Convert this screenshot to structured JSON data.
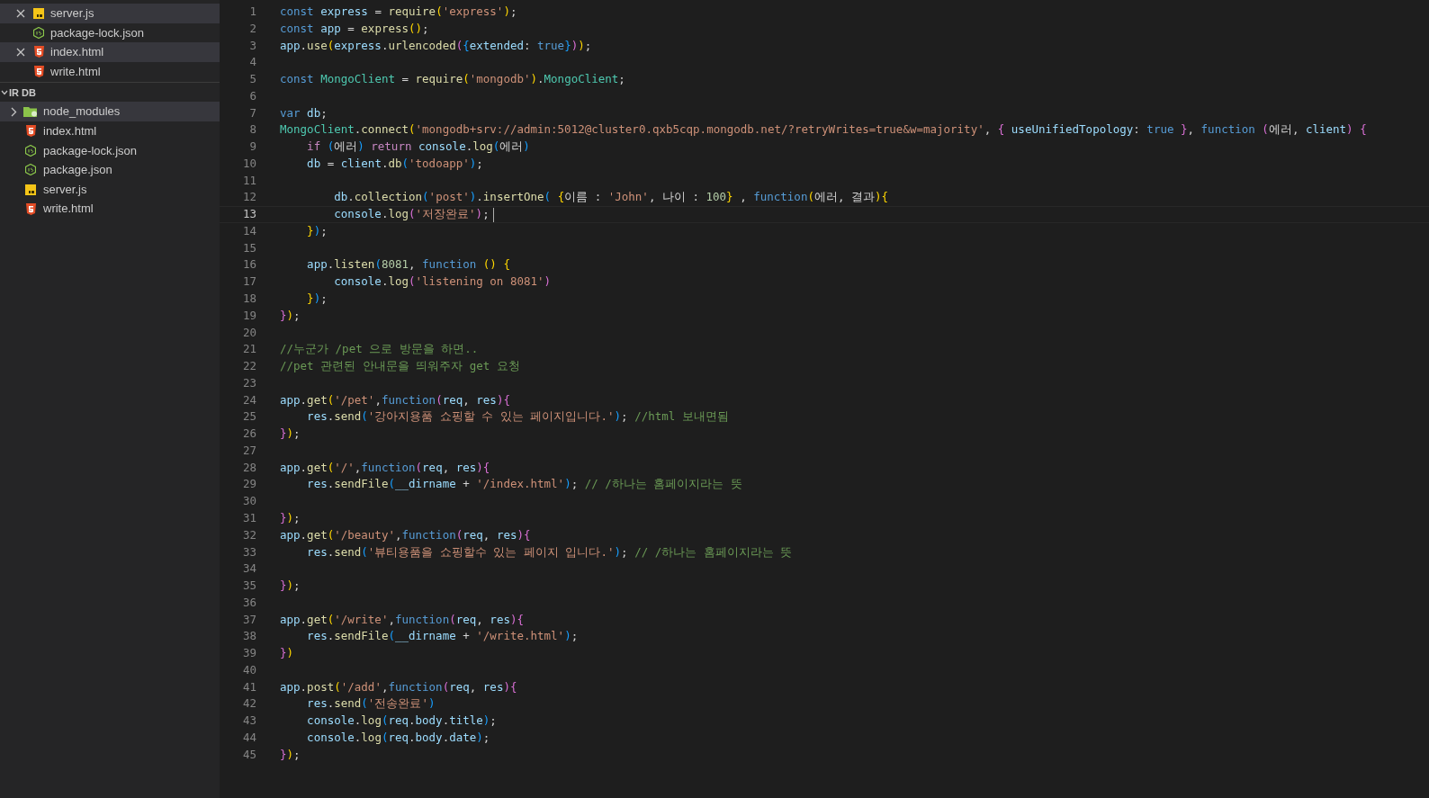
{
  "open_editors": [
    {
      "name": "server.js",
      "kind": "js",
      "selected": true
    },
    {
      "name": "package-lock.json",
      "kind": "json",
      "selected": false
    },
    {
      "name": "index.html",
      "kind": "html",
      "selected": true
    },
    {
      "name": "write.html",
      "kind": "html",
      "selected": false
    }
  ],
  "folder": {
    "name": "IR DB",
    "expanded": true,
    "items": [
      {
        "name": "node_modules",
        "kind": "folder",
        "expanded": false,
        "selected": true
      },
      {
        "name": "index.html",
        "kind": "html",
        "selected": false
      },
      {
        "name": "package-lock.json",
        "kind": "json",
        "selected": false
      },
      {
        "name": "package.json",
        "kind": "json",
        "selected": false
      },
      {
        "name": "server.js",
        "kind": "js",
        "selected": false
      },
      {
        "name": "write.html",
        "kind": "html",
        "selected": false
      }
    ]
  },
  "editor": {
    "lines": [
      {
        "number": "1",
        "text": "const express = require('express');",
        "active": false
      },
      {
        "number": "2",
        "text": "const app = express();",
        "active": false
      },
      {
        "number": "3",
        "text": "app.use(express.urlencoded({extended: true}));",
        "active": false
      },
      {
        "number": "4",
        "active": false
      },
      {
        "number": "5",
        "text": "const MongoClient = require('mongodb').MongoClient;",
        "active": false
      },
      {
        "number": "6",
        "active": false
      },
      {
        "number": "7",
        "text": "var db;",
        "active": false
      },
      {
        "number": "8",
        "text": "MongoClient.connect('mongodb+srv://admin:5012@cluster0.qxb5cqp.mongodb.net/?retryWrites=true&w=majority', { useUnifiedTopology: true }, function (에러, client) {",
        "active": false
      },
      {
        "number": "9",
        "text": "    if (에러) return console.log(에러)",
        "active": false
      },
      {
        "number": "10",
        "text": "    db = client.db('todoapp');",
        "active": false
      },
      {
        "number": "11",
        "active": false
      },
      {
        "number": "12",
        "text": "        db.collection('post').insertOne( {이름 : 'John', 나이 : 100} , function(에러, 결과){",
        "active": false
      },
      {
        "number": "13",
        "text": "        console.log('저장완료');",
        "active": true
      },
      {
        "number": "14",
        "text": "    });",
        "active": false
      },
      {
        "number": "15",
        "active": false
      },
      {
        "number": "16",
        "text": "    app.listen(8081, function () {",
        "active": false
      },
      {
        "number": "17",
        "text": "        console.log('listening on 8081')",
        "active": false
      },
      {
        "number": "18",
        "text": "    });",
        "active": false
      },
      {
        "number": "19",
        "text": "});",
        "active": false
      },
      {
        "number": "20",
        "active": false
      },
      {
        "number": "21",
        "text": "//누군가 /pet 으로 방문을 하면..",
        "active": false
      },
      {
        "number": "22",
        "text": "//pet 관련된 안내문을 띄워주자 get 요청",
        "active": false
      },
      {
        "number": "23",
        "active": false
      },
      {
        "number": "24",
        "text": "app.get('/pet',function(req, res){",
        "active": false
      },
      {
        "number": "25",
        "text": "    res.send('강아지용품 쇼핑할 수 있는 페이지입니다.'); //html 보내면됨",
        "active": false
      },
      {
        "number": "26",
        "text": "});",
        "active": false
      },
      {
        "number": "27",
        "active": false
      },
      {
        "number": "28",
        "text": "app.get('/',function(req, res){",
        "active": false
      },
      {
        "number": "29",
        "text": "    res.sendFile(__dirname + '/index.html'); // /하나는 홈페이지라는 뜻",
        "active": false
      },
      {
        "number": "30",
        "active": false
      },
      {
        "number": "31",
        "text": "});",
        "active": false
      },
      {
        "number": "32",
        "text": "app.get('/beauty',function(req, res){",
        "active": false
      },
      {
        "number": "33",
        "text": "    res.send('뷰티용품을 쇼핑할수 있는 페이지 입니다.'); // /하나는 홈페이지라는 뜻",
        "active": false
      },
      {
        "number": "34",
        "active": false
      },
      {
        "number": "35",
        "text": "});",
        "active": false
      },
      {
        "number": "36",
        "active": false
      },
      {
        "number": "37",
        "text": "app.get('/write',function(req, res){",
        "active": false
      },
      {
        "number": "38",
        "text": "    res.sendFile(__dirname + '/write.html');",
        "active": false
      },
      {
        "number": "39",
        "text": "})",
        "active": false
      },
      {
        "number": "40",
        "active": false
      },
      {
        "number": "41",
        "text": "app.post('/add',function(req, res){",
        "active": false
      },
      {
        "number": "42",
        "text": "    res.send('전송완료')",
        "active": false
      },
      {
        "number": "43",
        "text": "    console.log(req.body.title);",
        "active": false
      },
      {
        "number": "44",
        "text": "    console.log(req.body.date);",
        "active": false
      },
      {
        "number": "45",
        "text": "});",
        "active": false
      }
    ]
  }
}
